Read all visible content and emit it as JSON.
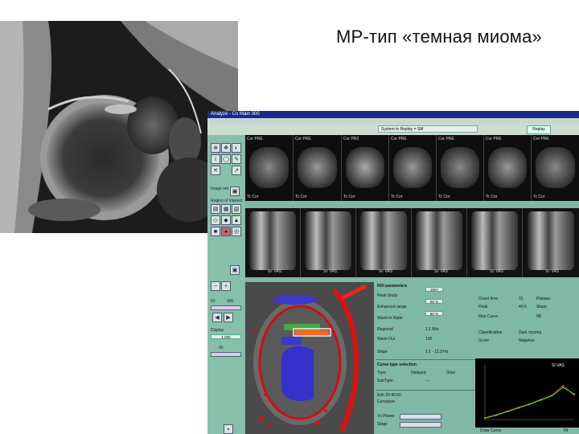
{
  "slide": {
    "title": "МР-тип «темная миома»"
  },
  "app": {
    "window_title": "Analyze - Co Main 300",
    "topbar_field": "System to Replay = SM",
    "topbar_button": "Replay",
    "row1_top_labels": [
      "Cor PRE",
      "Cor PRE",
      "Cor PR2",
      "Cor PRE",
      "Cor PRE",
      "Cor PRE",
      "Cor PRE"
    ],
    "row1_bottom_labels": [
      "Tc Cor",
      "Tc Cor",
      "Tc Cor",
      "Tc Cor",
      "Tc Cor",
      "Tc Cor",
      "Tc Cor"
    ],
    "row2_labels": [
      "SI: VAS",
      "SI: VAS",
      "SI: VAS",
      "SI: VAS",
      "SI: VAS",
      "SI: VAS"
    ],
    "left": {
      "section_image": "Image set",
      "section_roi": "Region of interest",
      "val_a": "50",
      "val_b": "400",
      "slider_value": "90",
      "section_display": "Display",
      "display_value": "1.000"
    },
    "params": {
      "header": "ROI parameters",
      "rows": [
        {
          "label": "Peak Study",
          "value": "2007"
        },
        {
          "label": "Enhanced range",
          "value": "99 %"
        },
        {
          "label": "Wash-In Ratio",
          "value": "80 %"
        },
        {
          "label": "Regional",
          "value": "1.1 Min"
        },
        {
          "label": "Wash-Out",
          "value": "130"
        },
        {
          "label": "Slope",
          "value": "1.1 - 11.3 Hz"
        }
      ],
      "sub_header": "Curve type selection",
      "sub_rows": [
        {
          "label": "Type",
          "value": "Delayed",
          "value2": "Slow"
        },
        {
          "label": "SubType",
          "value": "---"
        }
      ],
      "bottom_rows": [
        "Enh 20 40 60",
        "Curvature",
        "Vs Power",
        "Stage"
      ]
    },
    "params2": {
      "rows": [
        {
          "label": "Onset time",
          "value": "31",
          "extra": "Plateau"
        },
        {
          "label": "Peak",
          "value": "40.5",
          "extra": "Slope"
        },
        {
          "label": "Max Curve",
          "value": "98"
        },
        {
          "label": "Classification",
          "value": "Dark myoma"
        },
        {
          "label": "Score",
          "value": "Negative"
        }
      ]
    },
    "curve": {
      "legend": "SI VAS",
      "footer_left": "Draw Curve",
      "footer_right": "Fit"
    }
  },
  "chart_data": {
    "type": "line",
    "x": [
      1,
      2,
      3,
      4,
      5,
      6,
      7,
      8,
      9
    ],
    "series": [
      {
        "values": [
          3,
          8,
          14,
          20,
          26,
          33,
          40,
          56,
          40
        ],
        "color": "#ff3030"
      },
      {
        "values": [
          2,
          7,
          13,
          19,
          25,
          32,
          39,
          53,
          42
        ],
        "color": "#30ff30"
      }
    ],
    "ylim": [
      0,
      90
    ]
  }
}
